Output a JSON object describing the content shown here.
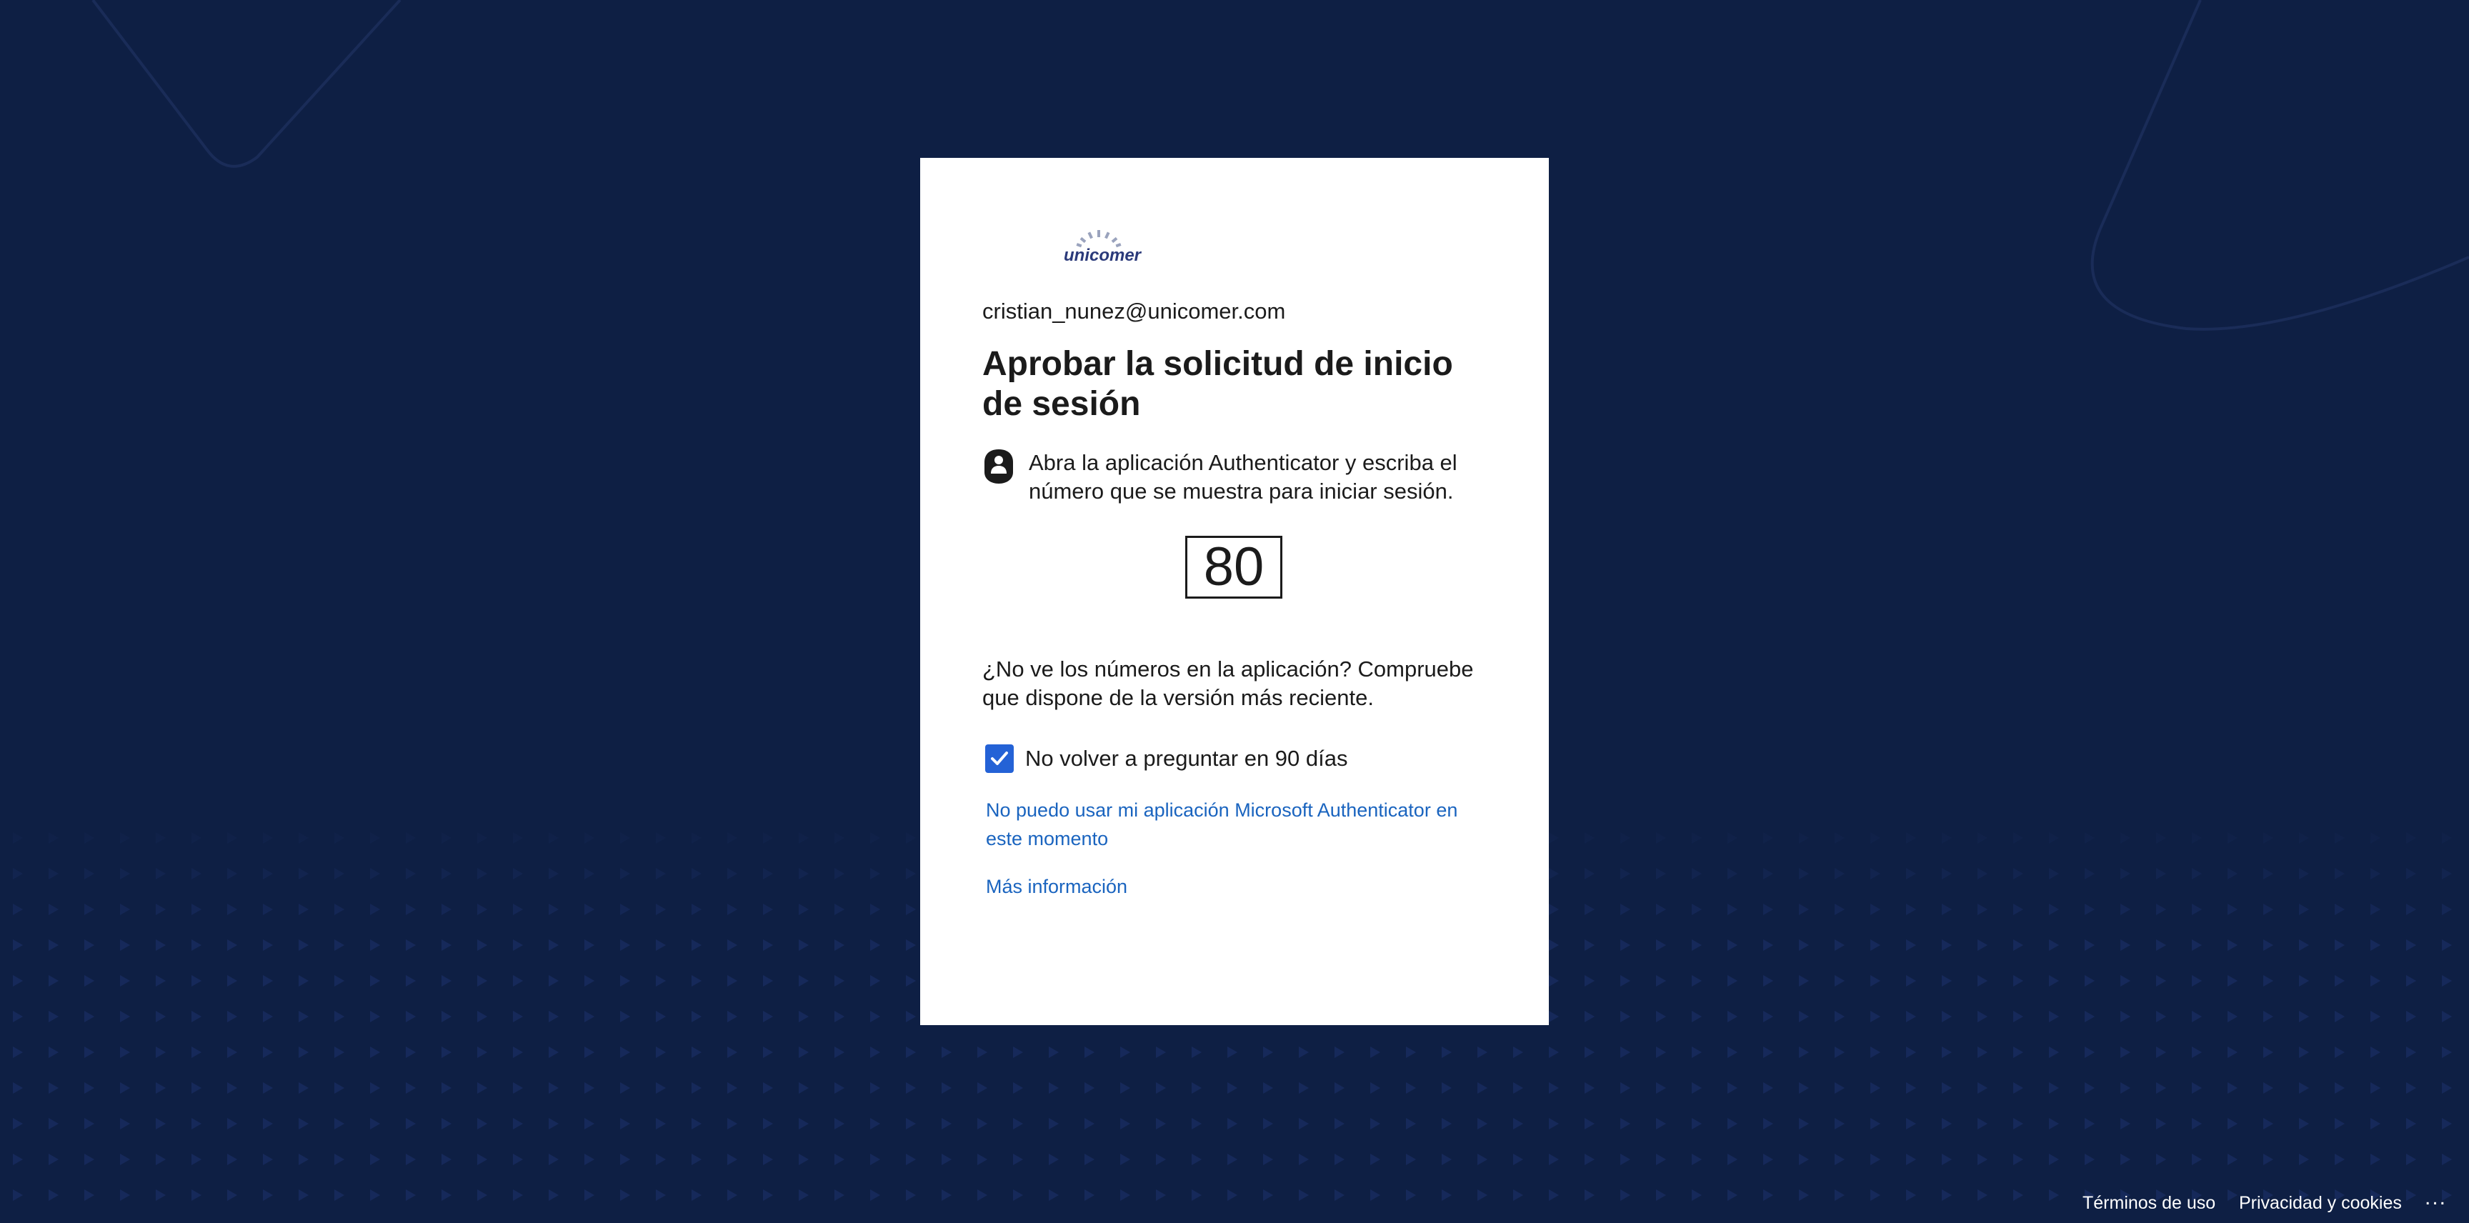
{
  "brand": {
    "logo_text": "unicomer"
  },
  "signin": {
    "email": "cristian_nunez@unicomer.com",
    "title": "Aprobar la solicitud de inicio de sesión",
    "instruction": "Abra la aplicación Authenticator y escriba el número que se muestra para iniciar sesión.",
    "number": "80",
    "hint": "¿No ve los números en la aplicación? Compruebe que dispone de la versión más reciente.",
    "remember_label": "No volver a preguntar en 90 días",
    "remember_checked": true,
    "cant_use_link": "No puedo usar mi aplicación Microsoft Authenticator en este momento",
    "more_info_link": "Más información"
  },
  "footer": {
    "terms": "Términos de uso",
    "privacy": "Privacidad y cookies",
    "more": "..."
  },
  "colors": {
    "background": "#0e1f44",
    "card": "#ffffff",
    "link": "#1a64bf",
    "checkbox": "#2462d6"
  },
  "icons": {
    "instruction_icon": "authenticator-lock-icon",
    "checkbox_icon": "checkmark-icon"
  }
}
